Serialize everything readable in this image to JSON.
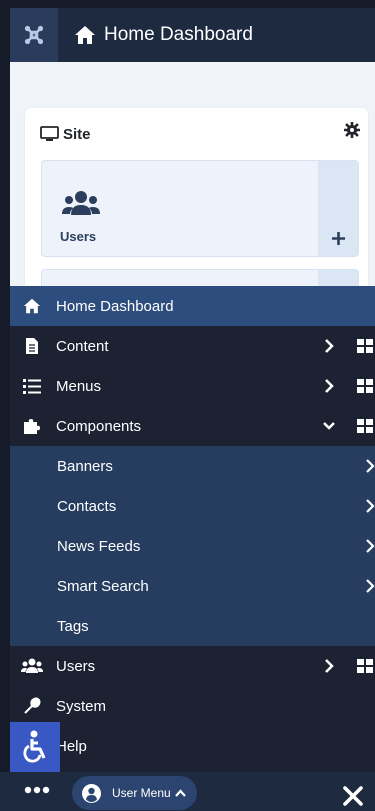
{
  "header": {
    "title": "Home Dashboard"
  },
  "card": {
    "title": "Site",
    "module": {
      "label": "Users"
    }
  },
  "menu": {
    "items": [
      {
        "label": "Home Dashboard",
        "icon": "home-icon"
      },
      {
        "label": "Content",
        "icon": "file-icon"
      },
      {
        "label": "Menus",
        "icon": "list-icon"
      },
      {
        "label": "Components",
        "icon": "puzzle-icon"
      },
      {
        "label": "Users",
        "icon": "users-icon"
      },
      {
        "label": "System",
        "icon": "wrench-icon"
      },
      {
        "label": "Help",
        "icon": "help-icon"
      }
    ],
    "sub_items": [
      {
        "label": "Banners"
      },
      {
        "label": "Contacts"
      },
      {
        "label": "News Feeds"
      },
      {
        "label": "Smart Search"
      },
      {
        "label": "Tags"
      }
    ]
  },
  "bottom": {
    "user_menu_label": "User Menu"
  },
  "colors": {
    "header_bg": "#1e2a40",
    "active_item_bg": "#2d4d7e",
    "submenu_bg": "#263d60",
    "accessibility_btn": "#3a58c4"
  }
}
